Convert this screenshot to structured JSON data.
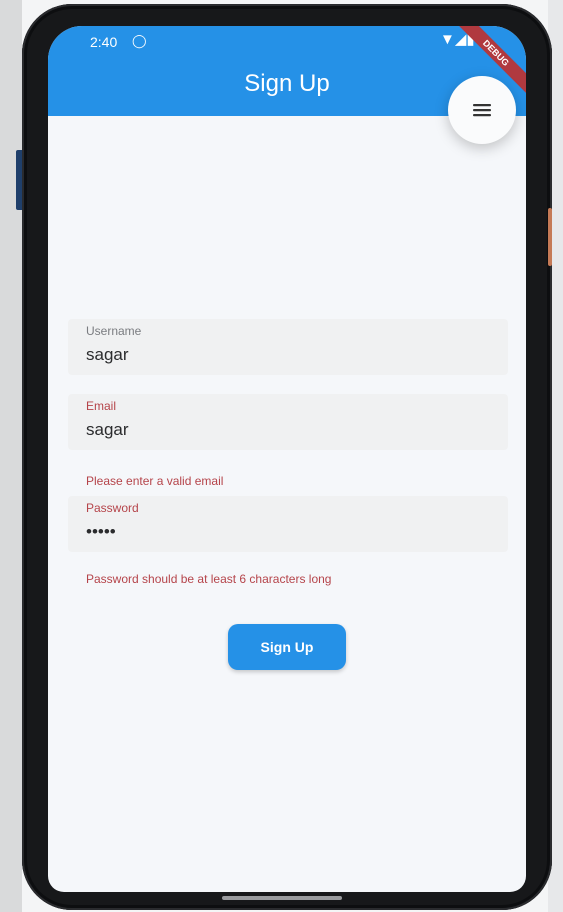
{
  "status_bar": {
    "time": "2:40",
    "left_icon": "shield-icon",
    "right_icons": "wifi-icon signal-icon battery-icon",
    "debug_banner": "DEBUG"
  },
  "app_bar": {
    "title": "Sign Up",
    "menu_icon": "menu-icon",
    "color": "#2591e7"
  },
  "form": {
    "username": {
      "label": "Username",
      "value": "sagar"
    },
    "email": {
      "label": "Email",
      "value": "sagar",
      "error": "Please enter a valid email"
    },
    "password": {
      "label": "Password",
      "value": "•••••",
      "error": "Password should be at least 6 characters long"
    },
    "submit_label": "Sign Up"
  },
  "colors": {
    "primary": "#2591e7",
    "error": "#b5444a",
    "background": "#f5f7fa"
  }
}
